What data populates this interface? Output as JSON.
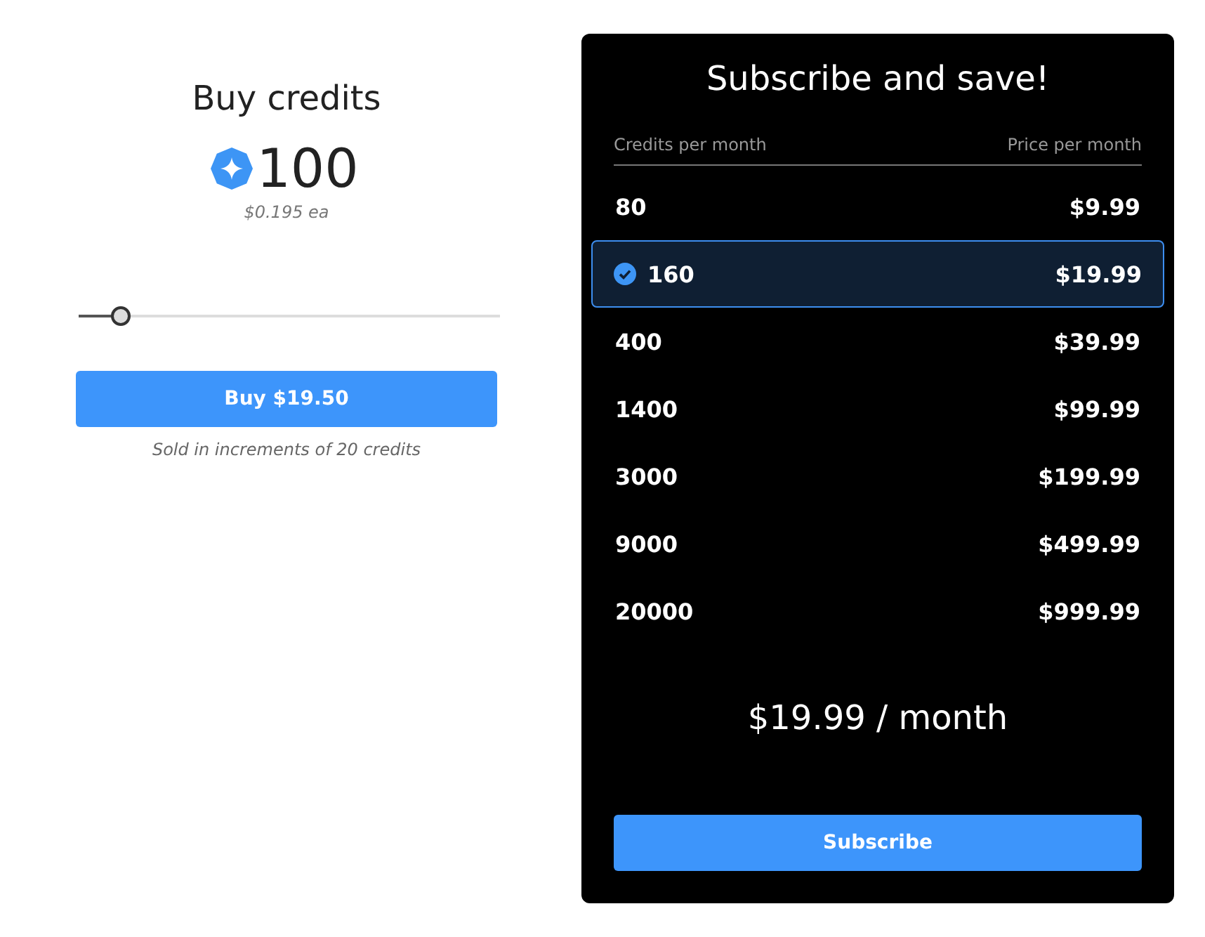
{
  "buy": {
    "title": "Buy credits",
    "amount": "100",
    "unit_price": "$0.195 ea",
    "slider": {
      "level": 0.1
    },
    "button": "Buy $19.50",
    "note": "Sold in increments of 20 credits"
  },
  "subscribe": {
    "title": "Subscribe and save!",
    "columns": [
      "Credits per month",
      "Price per month"
    ],
    "plans": [
      {
        "credits": "80",
        "price": "$9.99",
        "selected": false
      },
      {
        "credits": "160",
        "price": "$19.99",
        "selected": true
      },
      {
        "credits": "400",
        "price": "$39.99",
        "selected": false
      },
      {
        "credits": "1400",
        "price": "$99.99",
        "selected": false
      },
      {
        "credits": "3000",
        "price": "$199.99",
        "selected": false
      },
      {
        "credits": "9000",
        "price": "$499.99",
        "selected": false
      },
      {
        "credits": "20000",
        "price": "$999.99",
        "selected": false
      }
    ],
    "total": "$19.99 / month",
    "button": "Subscribe"
  }
}
